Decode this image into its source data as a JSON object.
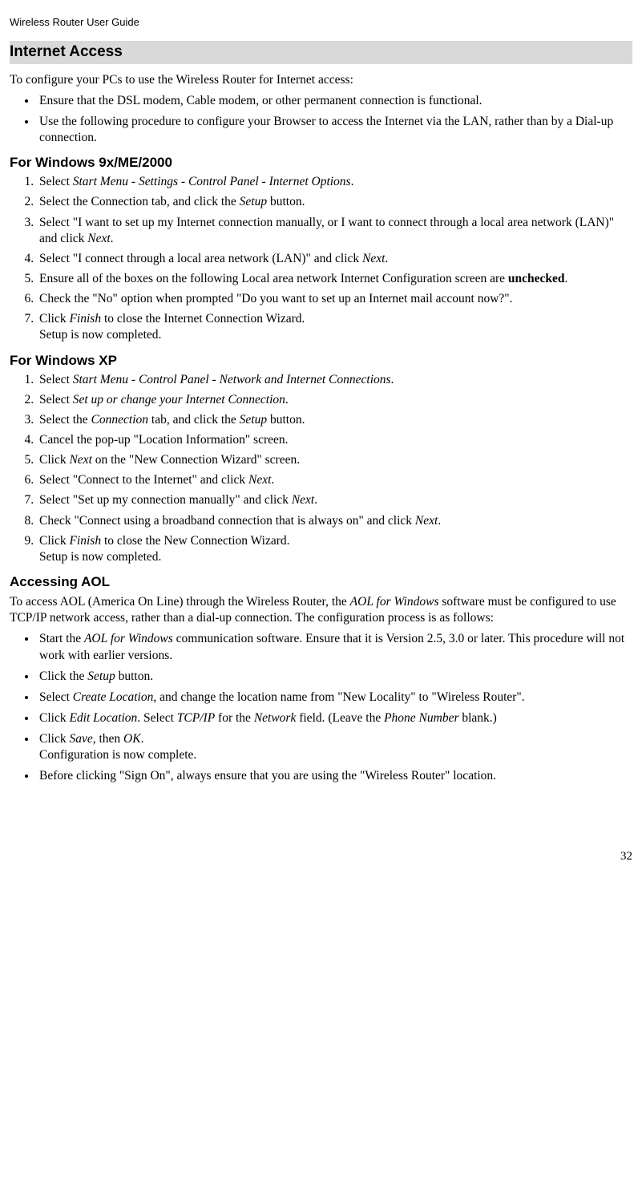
{
  "header": "Wireless Router User Guide",
  "h2_1": "Internet Access",
  "p1": "To configure your PCs to use the Wireless Router for Internet access:",
  "bul1_1": "Ensure that the DSL modem, Cable modem, or other permanent connection is functional.",
  "bul1_2": "Use the following procedure to configure your Browser to access the Internet via the LAN, rather than by a Dial-up connection.",
  "h3_1": "For Windows 9x/ME/2000",
  "ol1": {
    "i1a": "Select ",
    "i1b": "Start Menu - Settings - Control Panel - Internet Options",
    "i1c": ".",
    "i2a": "Select the Connection tab, and click the ",
    "i2b": "Setup",
    "i2c": " button.",
    "i3a": "Select \"I want to set up my Internet connection manually, or I want to connect through a local area network (LAN)\" and click ",
    "i3b": "Next",
    "i3c": ".",
    "i4a": "Select \"I connect through a local area network (LAN)\" and click ",
    "i4b": "Next",
    "i4c": ".",
    "i5a": "Ensure all of the boxes on the following Local area network Internet Configuration screen are ",
    "i5b": "unchecked",
    "i5c": ".",
    "i6": "Check the \"No\" option when prompted \"Do you want to set up an Internet mail account now?\".",
    "i7a": "Click ",
    "i7b": "Finish",
    "i7c": " to close the Internet Connection Wizard.",
    "i7d": "Setup is now completed."
  },
  "h3_2": "For Windows XP",
  "ol2": {
    "i1a": "Select ",
    "i1b": "Start Menu - Control Panel - Network and Internet Connections",
    "i1c": ".",
    "i2a": "Select ",
    "i2b": "Set up or change your Internet Connection",
    "i2c": ".",
    "i3a": "Select the ",
    "i3b": "Connection",
    "i3c": " tab, and click the ",
    "i3d": "Setup",
    "i3e": " button.",
    "i4": "Cancel the pop-up \"Location Information\" screen.",
    "i5a": "Click ",
    "i5b": "Next",
    "i5c": " on the \"New Connection Wizard\" screen.",
    "i6a": "Select \"Connect to the Internet\" and click ",
    "i6b": "Next",
    "i6c": ".",
    "i7a": "Select \"Set up my connection manually\" and click ",
    "i7b": "Next",
    "i7c": ".",
    "i8a": "Check \"Connect using a broadband connection that is always on\" and click ",
    "i8b": "Next",
    "i8c": ".",
    "i9a": "Click ",
    "i9b": "Finish",
    "i9c": " to close the New Connection Wizard.",
    "i9d": "Setup is now completed."
  },
  "h3_3": "Accessing AOL",
  "p3a": "To access AOL (America On Line) through the Wireless Router, the ",
  "p3b": "AOL for Windows",
  "p3c": " software must be configured to use TCP/IP network access, rather than a dial-up connection. The configuration process is as follows:",
  "bul3": {
    "i1a": "Start the ",
    "i1b": "AOL for Windows",
    "i1c": " communication software. Ensure that it is Version 2.5, 3.0 or later. This procedure will not work with earlier versions.",
    "i2a": "Click the ",
    "i2b": "Setup",
    "i2c": " button.",
    "i3a": "Select ",
    "i3b": "Create Location",
    "i3c": ", and change the location name from \"New Locality\" to \"Wireless Router\".",
    "i4a": "Click ",
    "i4b": "Edit Location",
    "i4c": ". Select ",
    "i4d": "TCP/IP",
    "i4e": " for the ",
    "i4f": "Network",
    "i4g": " field. (Leave the ",
    "i4h": "Phone Number",
    "i4i": " blank.)",
    "i5a": "Click ",
    "i5b": "Save",
    "i5c": ", then ",
    "i5d": "OK",
    "i5e": ".",
    "i5f": "Configuration is now complete.",
    "i6": "Before clicking \"Sign On\", always ensure that you are using the \"Wireless Router\" location."
  },
  "page_number": "32"
}
